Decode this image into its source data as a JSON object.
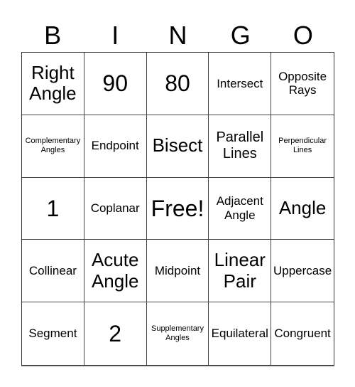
{
  "header": [
    "B",
    "I",
    "N",
    "G",
    "O"
  ],
  "cells": [
    {
      "text": "Right Angle",
      "size": "l"
    },
    {
      "text": "90",
      "size": "xl"
    },
    {
      "text": "80",
      "size": "xl"
    },
    {
      "text": "Intersect",
      "size": "s"
    },
    {
      "text": "Opposite Rays",
      "size": "s"
    },
    {
      "text": "Complementary Angles",
      "size": "xs"
    },
    {
      "text": "Endpoint",
      "size": "s"
    },
    {
      "text": "Bisect",
      "size": "l"
    },
    {
      "text": "Parallel Lines",
      "size": "m"
    },
    {
      "text": "Perpendicular Lines",
      "size": "xs"
    },
    {
      "text": "1",
      "size": "xl"
    },
    {
      "text": "Coplanar",
      "size": "s"
    },
    {
      "text": "Free!",
      "size": "xl"
    },
    {
      "text": "Adjacent Angle",
      "size": "s"
    },
    {
      "text": "Angle",
      "size": "l"
    },
    {
      "text": "Collinear",
      "size": "s"
    },
    {
      "text": "Acute Angle",
      "size": "l"
    },
    {
      "text": "Midpoint",
      "size": "s"
    },
    {
      "text": "Linear Pair",
      "size": "l"
    },
    {
      "text": "Uppercase",
      "size": "s"
    },
    {
      "text": "Segment",
      "size": "s"
    },
    {
      "text": "2",
      "size": "xl"
    },
    {
      "text": "Supplementary Angles",
      "size": "xs"
    },
    {
      "text": "Equilateral",
      "size": "s"
    },
    {
      "text": "Congruent",
      "size": "s"
    }
  ]
}
